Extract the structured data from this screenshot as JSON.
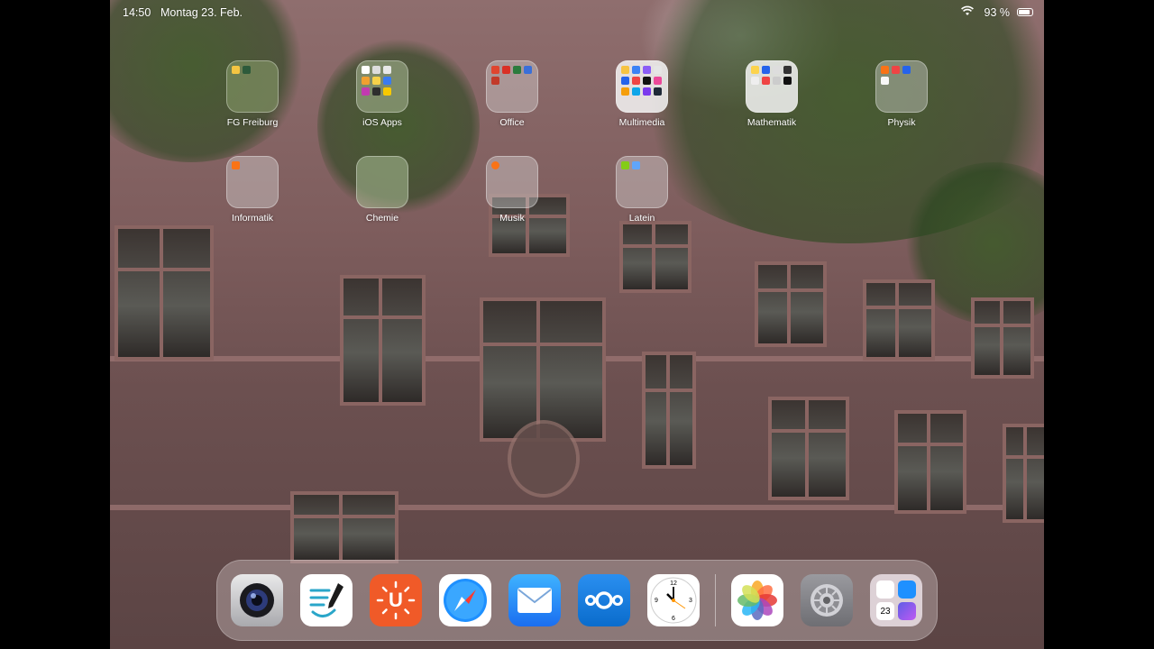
{
  "status_bar": {
    "time": "14:50",
    "date": "Montag 23. Feb.",
    "battery": "93 %",
    "battery_level": 0.93
  },
  "folders": [
    {
      "name": "FG Freiburg"
    },
    {
      "name": "iOS Apps"
    },
    {
      "name": "Office"
    },
    {
      "name": "Multimedia"
    },
    {
      "name": "Mathematik"
    },
    {
      "name": "Physik"
    },
    {
      "name": "Informatik"
    },
    {
      "name": "Chemie"
    },
    {
      "name": "Musik"
    },
    {
      "name": "Latein"
    }
  ],
  "dock": {
    "apps": [
      {
        "icon": "camera-app-icon"
      },
      {
        "icon": "notes-pen-app-icon"
      },
      {
        "icon": "u-app-icon",
        "letter": "U"
      },
      {
        "icon": "safari-icon"
      },
      {
        "icon": "mail-icon"
      },
      {
        "icon": "nextcloud-icon"
      },
      {
        "icon": "clock-icon"
      },
      {
        "icon": "photos-icon"
      },
      {
        "icon": "settings-icon"
      },
      {
        "icon": "app-library-icon",
        "calendar_day": "23"
      }
    ]
  }
}
